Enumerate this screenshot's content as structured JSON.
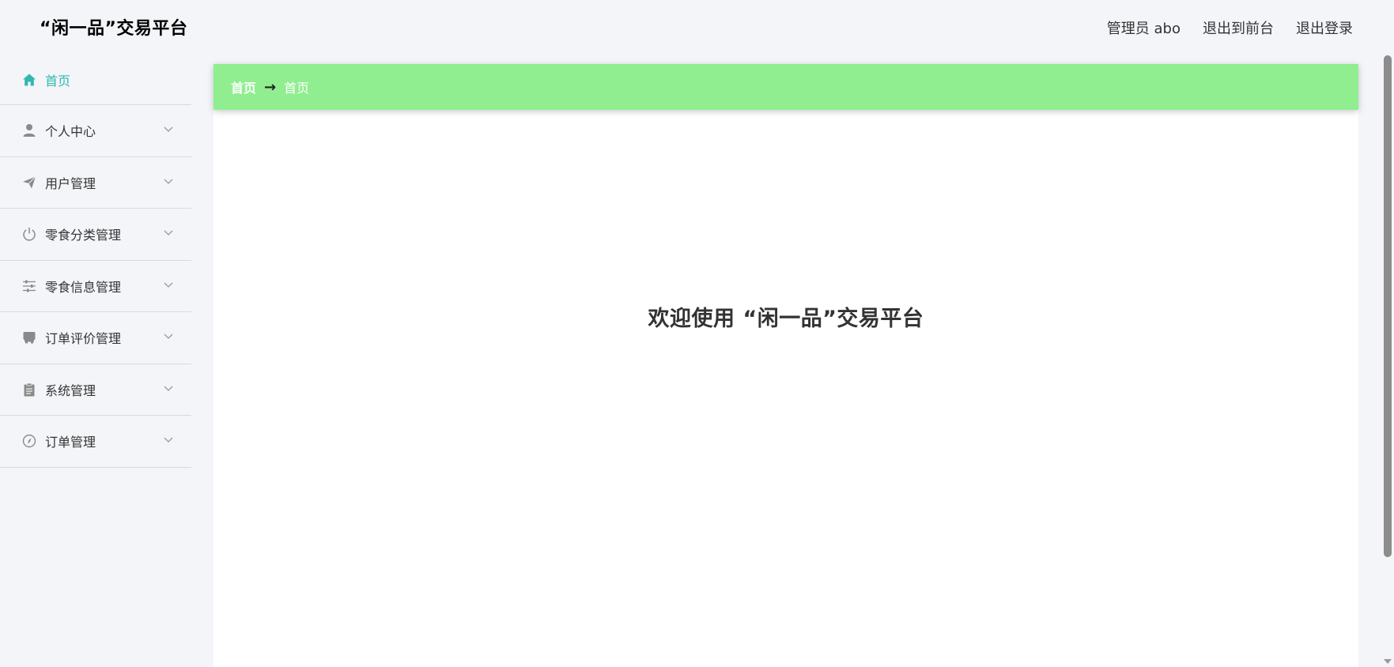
{
  "header": {
    "app_title": "“闲一品”交易平台",
    "user_label": "管理员 abo",
    "back_to_front": "退出到前台",
    "logout": "退出登录"
  },
  "sidebar": {
    "items": [
      {
        "label": "首页",
        "icon": "home-icon",
        "active": true
      },
      {
        "label": "个人中心",
        "icon": "user-icon"
      },
      {
        "label": "用户管理",
        "icon": "paper-plane-icon"
      },
      {
        "label": "零食分类管理",
        "icon": "power-icon"
      },
      {
        "label": "零食信息管理",
        "icon": "sliders-icon"
      },
      {
        "label": "订单评价管理",
        "icon": "inbox-icon"
      },
      {
        "label": "系统管理",
        "icon": "clipboard-icon"
      },
      {
        "label": "订单管理",
        "icon": "compass-icon"
      }
    ],
    "accent_color": "#2fb7b0"
  },
  "breadcrumb": {
    "first": "首页",
    "separator": "→",
    "second": "首页",
    "background_color": "#90ee90"
  },
  "main": {
    "welcome_text": "欢迎使用 “闲一品”交易平台"
  }
}
